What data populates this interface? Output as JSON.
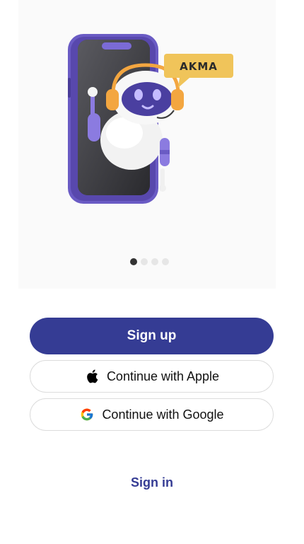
{
  "hero": {
    "bubble_text": "AKMA",
    "carousel": {
      "total": 4,
      "active_index": 0
    }
  },
  "actions": {
    "signup_label": "Sign up",
    "apple_label": "Continue with Apple",
    "google_label": "Continue with Google",
    "signin_label": "Sign in"
  },
  "icons": {
    "apple": "apple-icon",
    "google": "google-icon"
  },
  "colors": {
    "primary": "#353c94",
    "phone": "#6a5bc4",
    "bubble": "#f0c45a",
    "robot_accent": "#f3a640"
  }
}
